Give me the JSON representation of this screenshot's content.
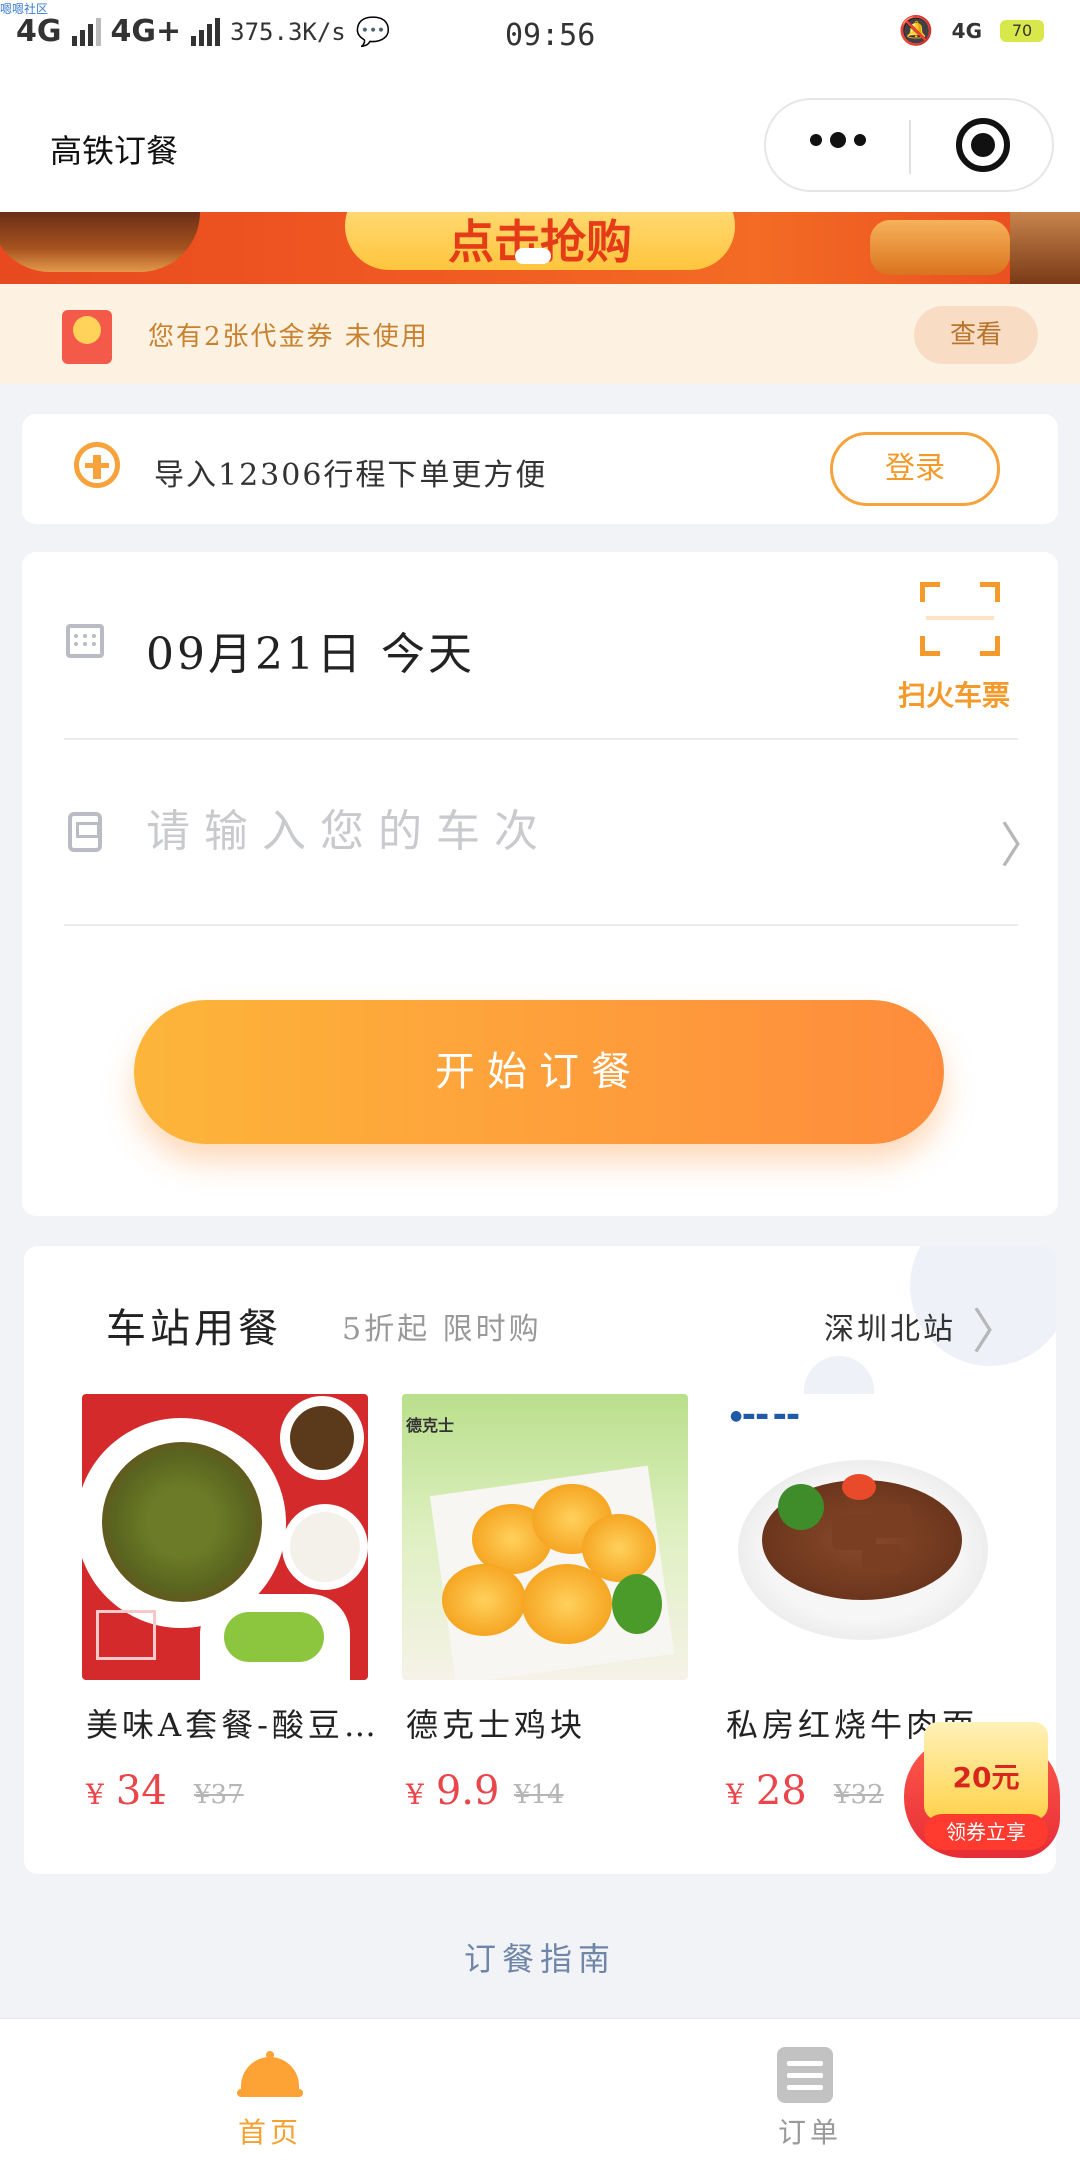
{
  "status_bar": {
    "corner_tag": "嗯嗯社区",
    "network1": "4G",
    "network2": "4G+",
    "speed": "375.3K/s",
    "time": "09:56",
    "net_right": "4G",
    "battery": "70"
  },
  "header": {
    "title": "高铁订餐",
    "more_icon": "more-dots-icon",
    "close_icon": "target-circle-icon"
  },
  "banner": {
    "button_text": "点击抢购"
  },
  "coupon": {
    "text": "您有2张代金券 未使用",
    "button": "查看"
  },
  "import_card": {
    "text": "导入12306行程下单更方便",
    "login_button": "登录"
  },
  "order_card": {
    "date": "09月21日 今天",
    "scan_label": "扫火车票",
    "train_placeholder": "请输入您的车次",
    "start_button": "开始订餐"
  },
  "station": {
    "title": "车站用餐",
    "subtitle": "5折起 限时购",
    "station_name": "深圳北站",
    "items": [
      {
        "name": "美味A套餐-酸豆…",
        "currency": "¥",
        "price": "34",
        "old_price": "¥37"
      },
      {
        "name": "德克士鸡块",
        "currency": "¥",
        "price": "9.9",
        "old_price": "¥14",
        "brand": "德克士"
      },
      {
        "name": "私房红烧牛肉面",
        "currency": "¥",
        "price": "28",
        "old_price": "¥32"
      }
    ]
  },
  "float_coupon": {
    "amount": "20元",
    "label": "领券立享"
  },
  "guide": "订餐指南",
  "tabbar": {
    "tabs": [
      {
        "label": "首页",
        "icon": "cloche-icon",
        "active": true
      },
      {
        "label": "订单",
        "icon": "list-icon",
        "active": false
      }
    ]
  },
  "colors": {
    "accent": "#f39a2b",
    "price": "#e9454a",
    "active_tab": "#f5a030",
    "inactive_tab": "#999999"
  }
}
